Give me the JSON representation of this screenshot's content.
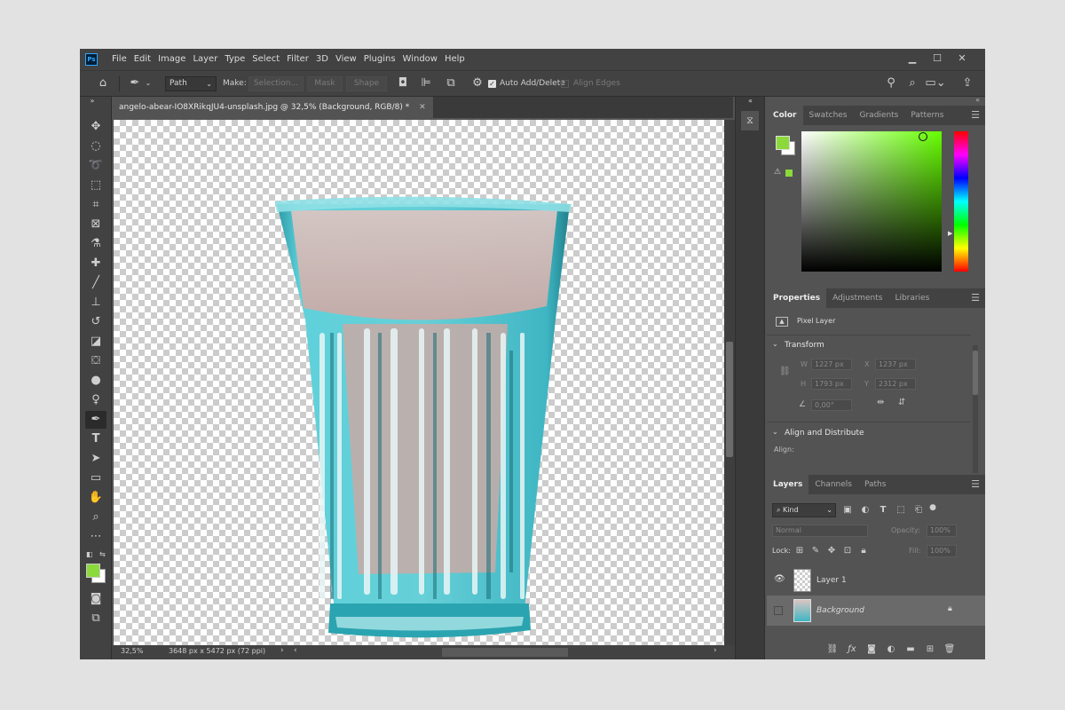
{
  "menubar": {
    "logo": "Ps",
    "items": [
      "File",
      "Edit",
      "Image",
      "Layer",
      "Type",
      "Select",
      "Filter",
      "3D",
      "View",
      "Plugins",
      "Window",
      "Help"
    ],
    "controls": [
      "▁",
      "☐",
      "✕"
    ]
  },
  "options": {
    "mode": "Path",
    "make_label": "Make:",
    "selection_btn": "Selection...",
    "mask_btn": "Mask",
    "shape_btn": "Shape",
    "auto_add_delete": "Auto Add/Delete",
    "align_edges": "Align Edges"
  },
  "document": {
    "tab_title": "angelo-abear-IO8XRikqJU4-unsplash.jpg @ 32,5% (Background, RGB/8) *",
    "zoom": "32,5%",
    "dimensions": "3648 px x 5472 px (72 ppi)"
  },
  "color_panel": {
    "tabs": [
      "Color",
      "Swatches",
      "Gradients",
      "Patterns"
    ],
    "active_tab": "Color",
    "foreground": "#8bd93b",
    "background": "#ffffff",
    "hue": "#66ff00"
  },
  "properties_panel": {
    "tabs": [
      "Properties",
      "Adjustments",
      "Libraries"
    ],
    "layer_type": "Pixel Layer",
    "transform_label": "Transform",
    "w_label": "W",
    "w_value": "1227 px",
    "x_label": "X",
    "x_value": "1237 px",
    "h_label": "H",
    "h_value": "1793 px",
    "y_label": "Y",
    "y_value": "2312 px",
    "angle_value": "0,00°",
    "align_label": "Align and Distribute",
    "align_sub": "Align:"
  },
  "layers_panel": {
    "tabs": [
      "Layers",
      "Channels",
      "Paths"
    ],
    "filter_kind": "Kind",
    "blend_mode": "Normal",
    "opacity_label": "Opacity:",
    "opacity_value": "100%",
    "lock_label": "Lock:",
    "fill_label": "Fill:",
    "fill_value": "100%",
    "layers": [
      {
        "name": "Layer 1",
        "visible": true,
        "selected": false
      },
      {
        "name": "Background",
        "visible": false,
        "selected": true,
        "locked": true
      }
    ]
  }
}
